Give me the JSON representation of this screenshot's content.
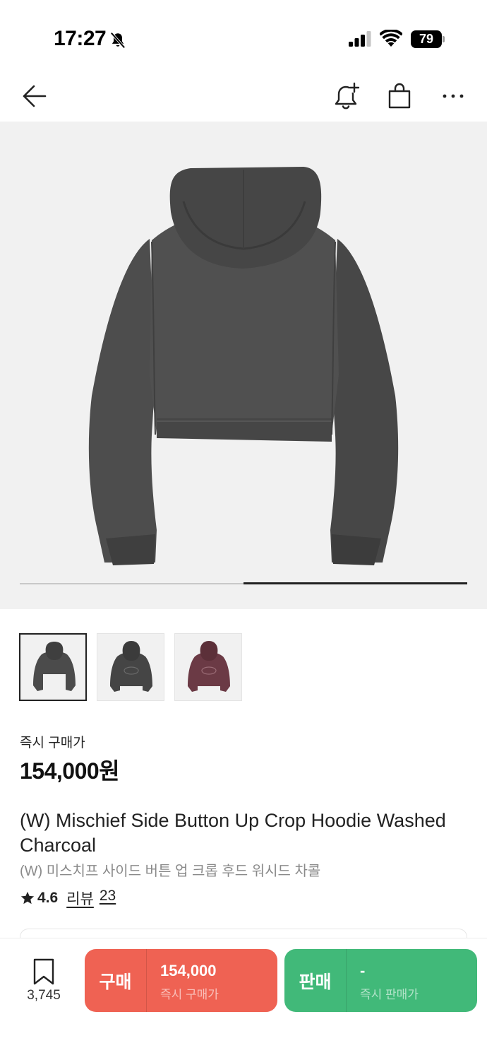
{
  "status_bar": {
    "time": "17:27",
    "battery": "79"
  },
  "nav": {
    "icons": [
      "arrow-left-icon",
      "bell-plus-icon",
      "shopping-bag-icon",
      "more-horizontal-icon"
    ]
  },
  "gallery": {
    "current_index": 2,
    "total": 2,
    "thumbnail_colors": [
      "#4b4b4b",
      "#454545",
      "#6b3a45"
    ]
  },
  "price": {
    "label": "즉시 구매가",
    "value": "154,000원"
  },
  "product": {
    "title_en": "(W) Mischief Side Button Up Crop Hoodie Washed Charcoal",
    "title_ko": "(W) 미스치프 사이드 버튼 업 크롭 후드 워시드 차콜",
    "rating": "4.6",
    "review_label": "리뷰",
    "review_count": "23"
  },
  "bottom_bar": {
    "wish_count": "3,745",
    "buy": {
      "label": "구매",
      "price": "154,000",
      "sub": "즉시 구매가",
      "color": "#ef6253"
    },
    "sell": {
      "label": "판매",
      "price": "-",
      "sub": "즉시 판매가",
      "color": "#41b979"
    }
  }
}
